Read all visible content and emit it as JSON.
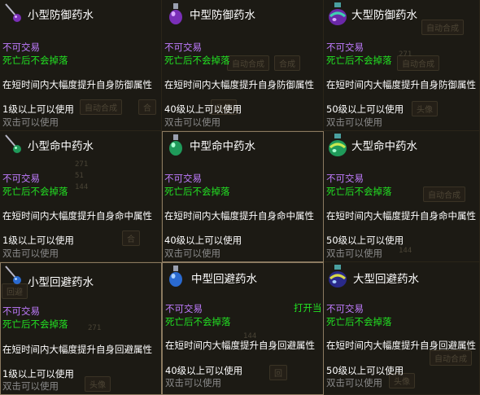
{
  "colors": {
    "name": "#ffffff",
    "trade": "#c07cff",
    "drop": "#22e022",
    "desc": "#ffffff",
    "use_hint": "#8a8a8a"
  },
  "items": [
    {
      "name": "小型防御药水",
      "trade": "不可交易",
      "drop": "死亡后不会掉落",
      "desc": "在短时间内大幅度提升自身防御属性",
      "level": "1级以上可以使用",
      "use": "双击可以使用",
      "icon": "small-purple-potion-icon"
    },
    {
      "name": "中型防御药水",
      "trade": "不可交易",
      "drop": "死亡后不会掉落",
      "desc": "在短时间内大幅度提升自身防御属性",
      "level": "40级以上可以使用",
      "use": "双击可以使用",
      "icon": "medium-purple-potion-icon"
    },
    {
      "name": "大型防御药水",
      "trade": "不可交易",
      "drop": "死亡后不会掉落",
      "desc": "在短时间内大幅度提升自身防御属性",
      "level": "50级以上可以使用",
      "use": "双击可以使用",
      "icon": "large-purple-potion-icon"
    },
    {
      "name": "小型命中药水",
      "trade": "不可交易",
      "drop": "死亡后不会掉落",
      "desc": "在短时间内大幅度提升自身命中属性",
      "level": "1级以上可以使用",
      "use": "双击可以使用",
      "icon": "small-green-potion-icon"
    },
    {
      "name": "中型命中药水",
      "trade": "不可交易",
      "drop": "死亡后不会掉落",
      "desc": "在短时间内大幅度提升自身命中属性",
      "level": "40级以上可以使用",
      "use": "双击可以使用",
      "icon": "medium-green-potion-icon"
    },
    {
      "name": "大型命中药水",
      "trade": "不可交易",
      "drop": "死亡后不会掉落",
      "desc": "在短时间内大幅度提升自身命中属性",
      "level": "50级以上可以使用",
      "use": "双击可以使用",
      "icon": "large-green-potion-icon"
    },
    {
      "name": "小型回避药水",
      "trade": "不可交易",
      "drop": "死亡后不会掉落",
      "desc": "在短时间内大幅度提升自身回避属性",
      "level": "1级以上可以使用",
      "use": "双击可以使用",
      "icon": "small-blue-potion-icon"
    },
    {
      "name": "中型回避药水",
      "trade": "不可交易",
      "drop": "死亡后不会掉落",
      "desc": "在短时间内大幅度提升自身回避属性",
      "level": "40级以上可以使用",
      "use": "双击可以使用",
      "icon": "medium-blue-potion-icon",
      "extra": "打开当"
    },
    {
      "name": "大型回避药水",
      "trade": "不可交易",
      "drop": "死亡后不会掉落",
      "desc": "在短时间内大幅度提升自身回避属性",
      "level": "50级以上可以使用",
      "use": "双击可以使用",
      "icon": "large-blue-potion-icon"
    }
  ]
}
